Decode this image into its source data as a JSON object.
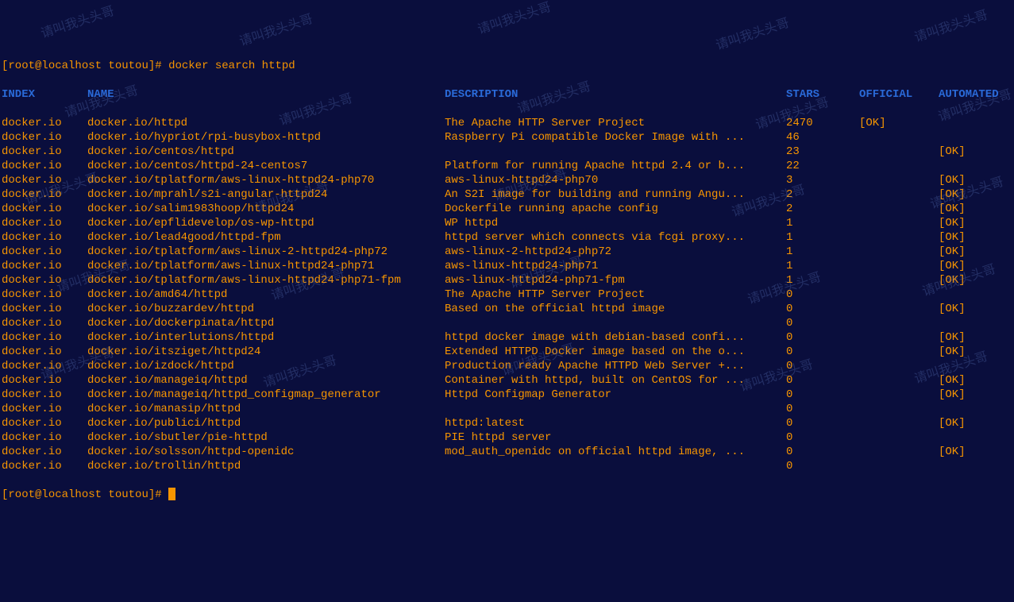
{
  "prompt1": {
    "bracket_open": "[",
    "user": "root@localhost",
    "dir": " toutou",
    "bracket_close": "]",
    "hash": "# ",
    "command": "docker search httpd"
  },
  "headers": {
    "index": "INDEX",
    "name": "NAME",
    "description": "DESCRIPTION",
    "stars": "STARS",
    "official": "OFFICIAL",
    "automated": "AUTOMATED"
  },
  "rows": [
    {
      "index": "docker.io",
      "name": "docker.io/httpd",
      "desc": "The Apache HTTP Server Project",
      "stars": "2470",
      "official": "[OK]",
      "automated": ""
    },
    {
      "index": "docker.io",
      "name": "docker.io/hypriot/rpi-busybox-httpd",
      "desc": "Raspberry Pi compatible Docker Image with ...",
      "stars": "46",
      "official": "",
      "automated": ""
    },
    {
      "index": "docker.io",
      "name": "docker.io/centos/httpd",
      "desc": "",
      "stars": "23",
      "official": "",
      "automated": "[OK]"
    },
    {
      "index": "docker.io",
      "name": "docker.io/centos/httpd-24-centos7",
      "desc": "Platform for running Apache httpd 2.4 or b...",
      "stars": "22",
      "official": "",
      "automated": ""
    },
    {
      "index": "docker.io",
      "name": "docker.io/tplatform/aws-linux-httpd24-php70",
      "desc": "aws-linux-httpd24-php70",
      "stars": "3",
      "official": "",
      "automated": "[OK]"
    },
    {
      "index": "docker.io",
      "name": "docker.io/mprahl/s2i-angular-httpd24",
      "desc": "An S2I image for building and running Angu...",
      "stars": "2",
      "official": "",
      "automated": "[OK]"
    },
    {
      "index": "docker.io",
      "name": "docker.io/salim1983hoop/httpd24",
      "desc": "Dockerfile running apache config",
      "stars": "2",
      "official": "",
      "automated": "[OK]"
    },
    {
      "index": "docker.io",
      "name": "docker.io/epflidevelop/os-wp-httpd",
      "desc": "WP httpd",
      "stars": "1",
      "official": "",
      "automated": "[OK]"
    },
    {
      "index": "docker.io",
      "name": "docker.io/lead4good/httpd-fpm",
      "desc": "httpd server which connects via fcgi proxy...",
      "stars": "1",
      "official": "",
      "automated": "[OK]"
    },
    {
      "index": "docker.io",
      "name": "docker.io/tplatform/aws-linux-2-httpd24-php72",
      "desc": "aws-linux-2-httpd24-php72",
      "stars": "1",
      "official": "",
      "automated": "[OK]"
    },
    {
      "index": "docker.io",
      "name": "docker.io/tplatform/aws-linux-httpd24-php71",
      "desc": "aws-linux-httpd24-php71",
      "stars": "1",
      "official": "",
      "automated": "[OK]"
    },
    {
      "index": "docker.io",
      "name": "docker.io/tplatform/aws-linux-httpd24-php71-fpm",
      "desc": "aws-linux-httpd24-php71-fpm",
      "stars": "1",
      "official": "",
      "automated": "[OK]"
    },
    {
      "index": "docker.io",
      "name": "docker.io/amd64/httpd",
      "desc": "The Apache HTTP Server Project",
      "stars": "0",
      "official": "",
      "automated": ""
    },
    {
      "index": "docker.io",
      "name": "docker.io/buzzardev/httpd",
      "desc": "Based on the official httpd image",
      "stars": "0",
      "official": "",
      "automated": "[OK]"
    },
    {
      "index": "docker.io",
      "name": "docker.io/dockerpinata/httpd",
      "desc": "",
      "stars": "0",
      "official": "",
      "automated": ""
    },
    {
      "index": "docker.io",
      "name": "docker.io/interlutions/httpd",
      "desc": "httpd docker image with debian-based confi...",
      "stars": "0",
      "official": "",
      "automated": "[OK]"
    },
    {
      "index": "docker.io",
      "name": "docker.io/itsziget/httpd24",
      "desc": "Extended HTTPD Docker image based on the o...",
      "stars": "0",
      "official": "",
      "automated": "[OK]"
    },
    {
      "index": "docker.io",
      "name": "docker.io/izdock/httpd",
      "desc": "Production ready Apache HTTPD Web Server +...",
      "stars": "0",
      "official": "",
      "automated": ""
    },
    {
      "index": "docker.io",
      "name": "docker.io/manageiq/httpd",
      "desc": "Container with httpd, built on CentOS for ...",
      "stars": "0",
      "official": "",
      "automated": "[OK]"
    },
    {
      "index": "docker.io",
      "name": "docker.io/manageiq/httpd_configmap_generator",
      "desc": "Httpd Configmap Generator",
      "stars": "0",
      "official": "",
      "automated": "[OK]"
    },
    {
      "index": "docker.io",
      "name": "docker.io/manasip/httpd",
      "desc": "",
      "stars": "0",
      "official": "",
      "automated": ""
    },
    {
      "index": "docker.io",
      "name": "docker.io/publici/httpd",
      "desc": "httpd:latest",
      "stars": "0",
      "official": "",
      "automated": "[OK]"
    },
    {
      "index": "docker.io",
      "name": "docker.io/sbutler/pie-httpd",
      "desc": "PIE httpd server",
      "stars": "0",
      "official": "",
      "automated": ""
    },
    {
      "index": "docker.io",
      "name": "docker.io/solsson/httpd-openidc",
      "desc": "mod_auth_openidc on official httpd image, ...",
      "stars": "0",
      "official": "",
      "automated": "[OK]"
    },
    {
      "index": "docker.io",
      "name": "docker.io/trollin/httpd",
      "desc": "",
      "stars": "0",
      "official": "",
      "automated": ""
    }
  ],
  "prompt2": {
    "bracket_open": "[",
    "user": "root@localhost",
    "dir": " toutou",
    "bracket_close": "]",
    "hash": "# "
  },
  "watermark_text": "请叫我头头哥"
}
